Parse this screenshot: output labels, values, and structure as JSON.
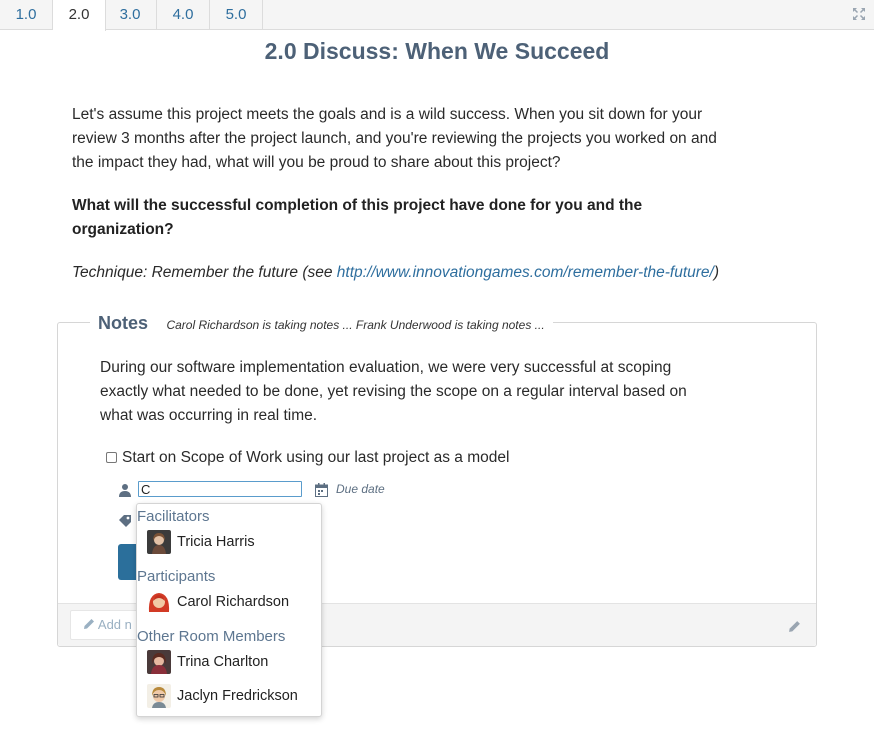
{
  "tabs": [
    {
      "label": "1.0"
    },
    {
      "label": "2.0",
      "active": true
    },
    {
      "label": "3.0"
    },
    {
      "label": "4.0"
    },
    {
      "label": "5.0"
    }
  ],
  "page": {
    "title": "2.0 Discuss: When We Succeed",
    "intro": "Let's assume this project meets the goals and is a wild success. When you sit down for your review 3 months after the project launch, and you're reviewing the projects you worked on and the impact they had, what will you be proud to share about this project?",
    "question": "What will the successful completion of this project  have done  for you and the organization?",
    "technique_prefix": "Technique: Remember the future (see ",
    "technique_link": "http://www.innovationgames.com/remember-the-future/",
    "technique_suffix": ")"
  },
  "notes": {
    "title": "Notes",
    "status": "Carol Richardson is taking notes ...  Frank Underwood is taking notes ...",
    "text": "During our software implementation evaluation, we were very successful at scoping exactly what needed to be done, yet revising the scope on a regular interval based on what was occurring in real time.",
    "task": "Start on Scope of Work using our last project as a model",
    "assignee_value": "C",
    "due_date_label": "Due date",
    "add_note_label": "Add n"
  },
  "dropdown": {
    "groups": [
      {
        "label": "Facilitators",
        "members": [
          {
            "name": "Tricia Harris"
          }
        ]
      },
      {
        "label": "Participants",
        "members": [
          {
            "name": "Carol Richardson"
          }
        ]
      },
      {
        "label": "Other Room Members",
        "members": [
          {
            "name": "Trina Charlton"
          },
          {
            "name": "Jaclyn Fredrickson"
          }
        ]
      }
    ]
  },
  "colors": {
    "accent": "#2e6e9e",
    "title": "#4d6177",
    "group_label": "#5d7690"
  }
}
